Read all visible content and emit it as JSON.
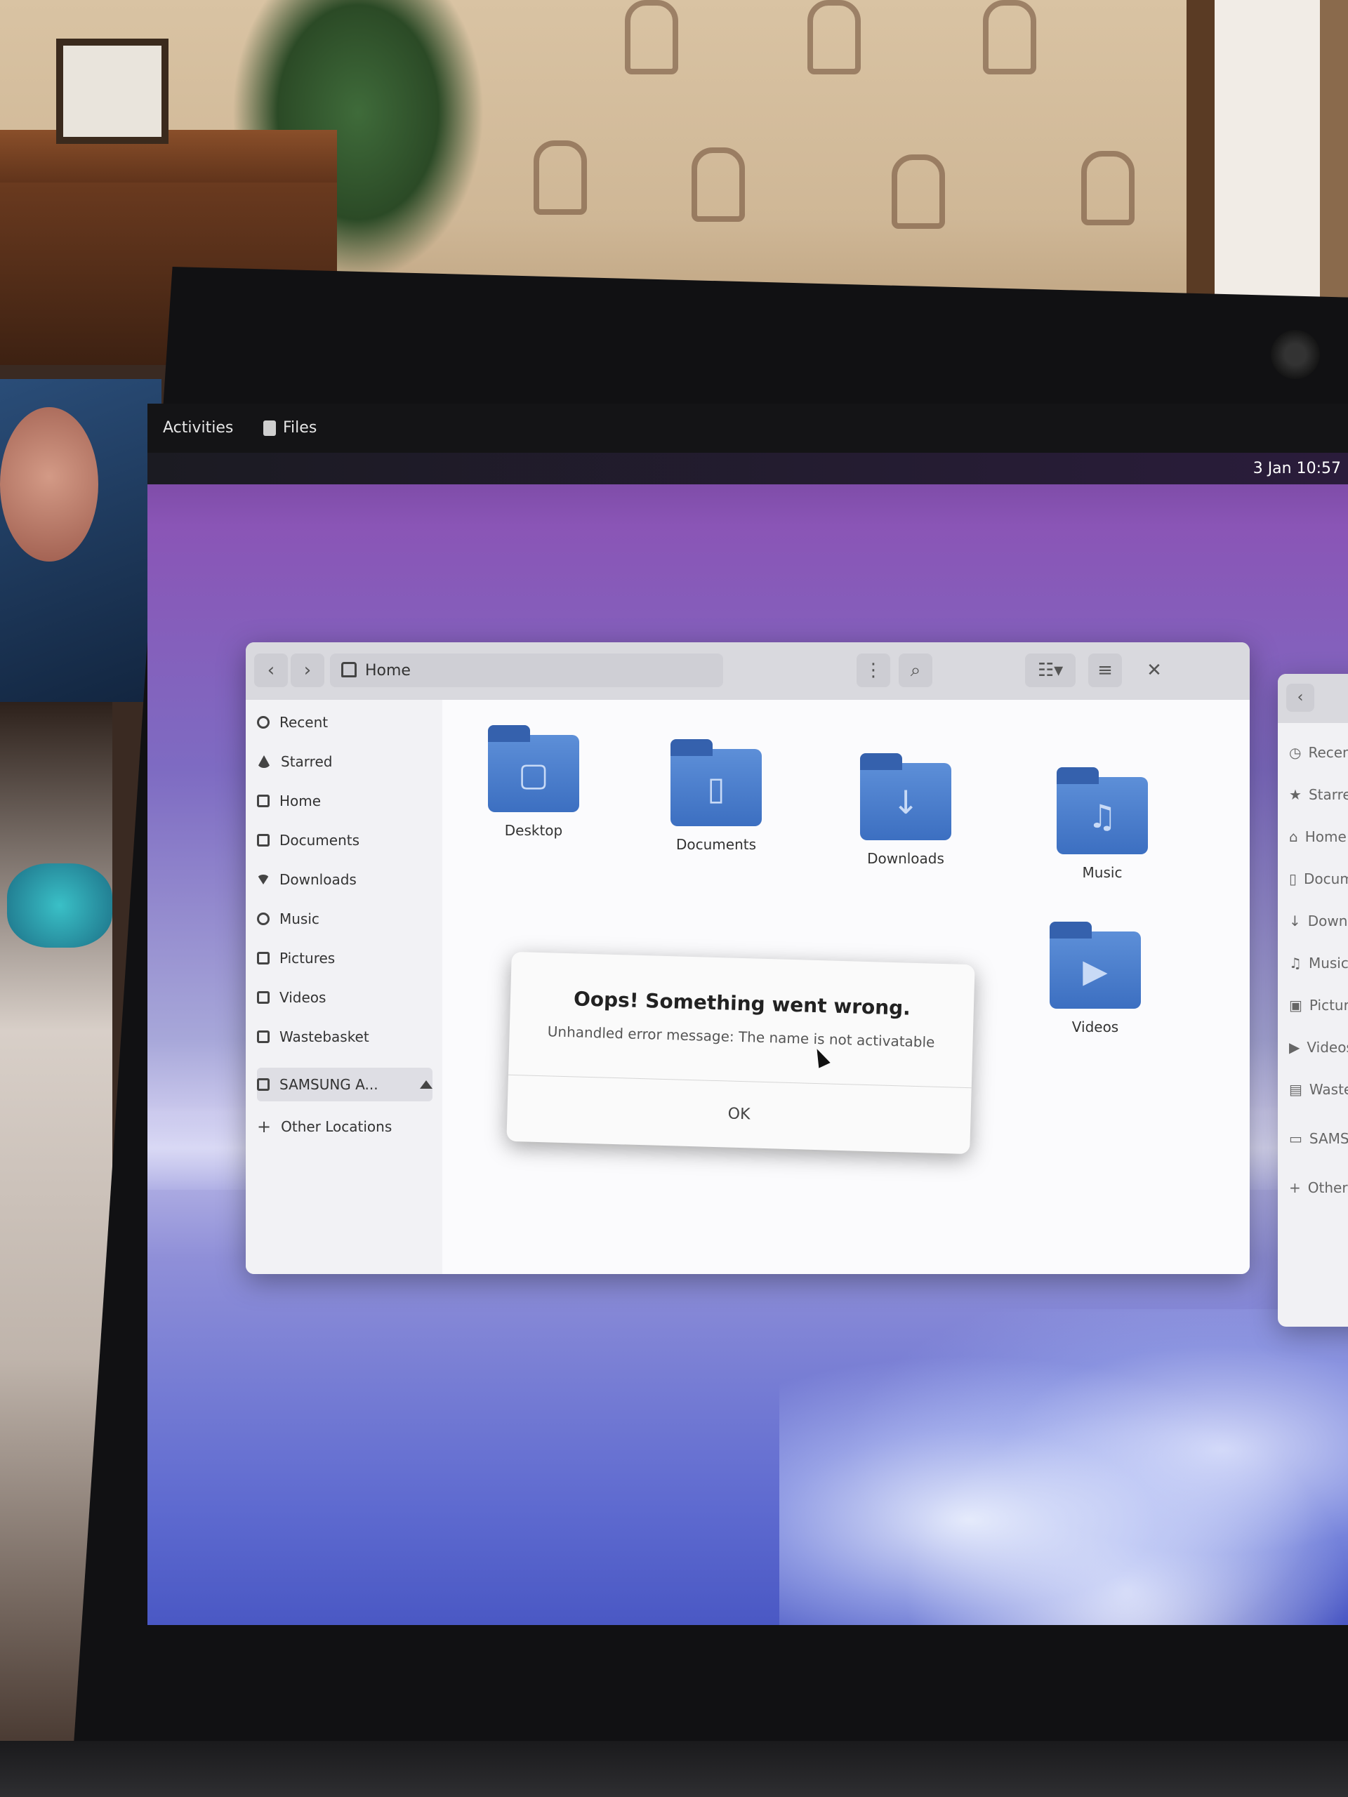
{
  "topbar": {
    "activities": "Activities",
    "app_menu": "Files",
    "clock": "3 Jan 10:57"
  },
  "files_window": {
    "path": "Home",
    "sidebar": [
      {
        "label": "Recent",
        "icon": "clock-icon"
      },
      {
        "label": "Starred",
        "icon": "star-icon"
      },
      {
        "label": "Home",
        "icon": "home-icon"
      },
      {
        "label": "Documents",
        "icon": "document-icon"
      },
      {
        "label": "Downloads",
        "icon": "download-icon"
      },
      {
        "label": "Music",
        "icon": "music-icon"
      },
      {
        "label": "Pictures",
        "icon": "picture-icon"
      },
      {
        "label": "Videos",
        "icon": "video-icon"
      },
      {
        "label": "Wastebasket",
        "icon": "trash-icon"
      },
      {
        "label": "SAMSUNG A...",
        "icon": "drive-icon"
      },
      {
        "label": "Other Locations",
        "icon": "plus-icon"
      }
    ],
    "folders": [
      {
        "label": "Desktop",
        "icon": "desktop-folder-icon"
      },
      {
        "label": "Documents",
        "icon": "documents-folder-icon"
      },
      {
        "label": "Downloads",
        "icon": "downloads-folder-icon"
      },
      {
        "label": "Music",
        "icon": "music-folder-icon"
      },
      {
        "label": "Videos",
        "icon": "videos-folder-icon"
      }
    ]
  },
  "dialog": {
    "title": "Oops! Something went wrong.",
    "message": "Unhandled error message: The name is not activatable",
    "ok_label": "OK"
  },
  "second_window": {
    "sidebar": [
      "Recent",
      "Starred",
      "Home",
      "Documents",
      "Downloads",
      "Music",
      "Pictures",
      "Videos",
      "Wastebasket",
      "SAMSUNG",
      "Other Locations"
    ]
  },
  "colors": {
    "folder_blue": "#3c6fc1",
    "topbar_bg": "#141416",
    "wallpaper_purple": "#8a55b6"
  }
}
